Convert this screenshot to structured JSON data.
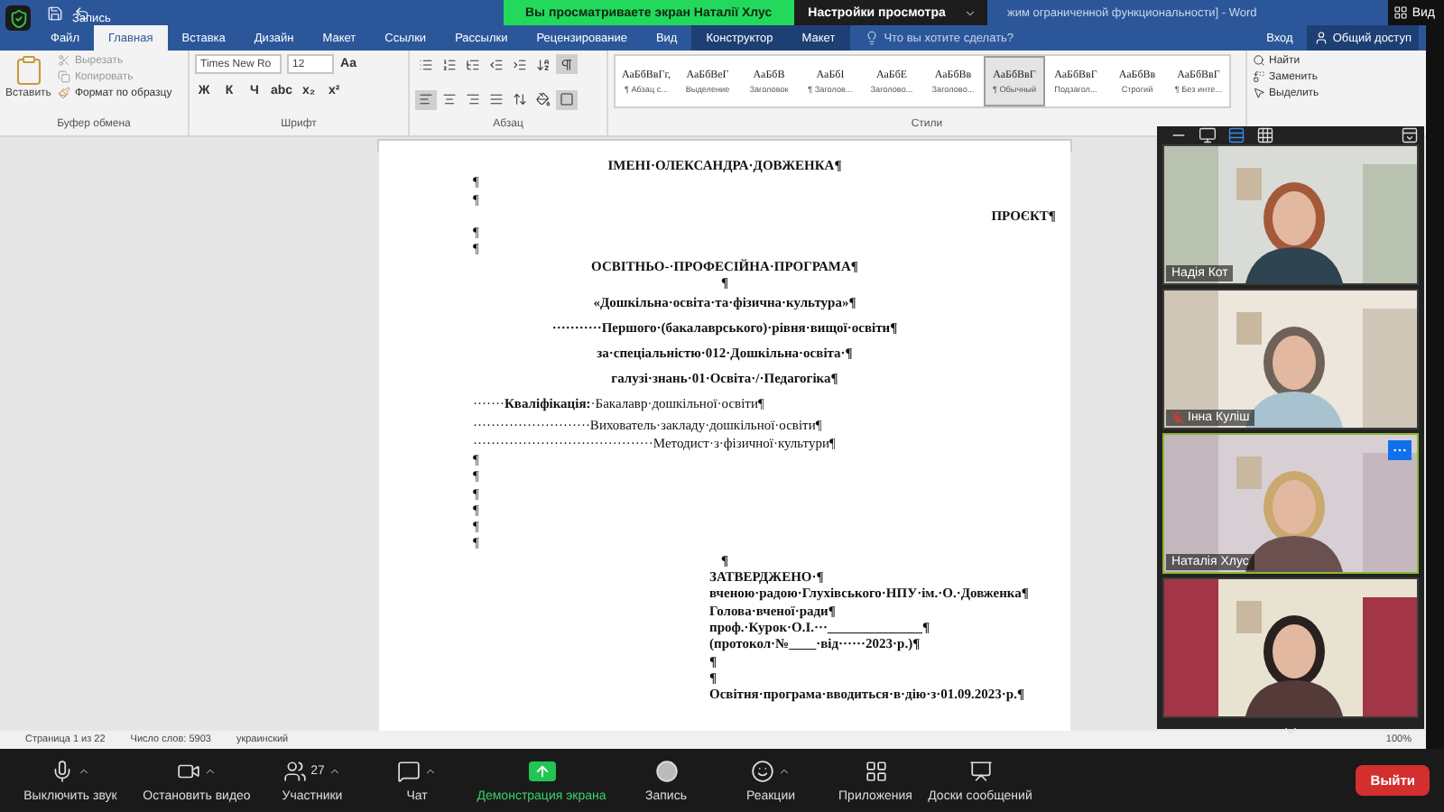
{
  "zoom_header": {
    "recording_label": "Запись",
    "view_button": "Вид"
  },
  "share_banner": {
    "text": "Вы просматриваете экран Наталії Хлус",
    "options_button": "Настройки просмотра"
  },
  "window": {
    "title": "жим ограниченной функциональности] - Word"
  },
  "ribbon_tabs": [
    {
      "label": "Файл",
      "selected": false,
      "contextual": false
    },
    {
      "label": "Главная",
      "selected": true,
      "contextual": false
    },
    {
      "label": "Вставка",
      "selected": false,
      "contextual": false
    },
    {
      "label": "Дизайн",
      "selected": false,
      "contextual": false
    },
    {
      "label": "Макет",
      "selected": false,
      "contextual": false
    },
    {
      "label": "Ссылки",
      "selected": false,
      "contextual": false
    },
    {
      "label": "Рассылки",
      "selected": false,
      "contextual": false
    },
    {
      "label": "Рецензирование",
      "selected": false,
      "contextual": false
    },
    {
      "label": "Вид",
      "selected": false,
      "contextual": false
    },
    {
      "label": "Конструктор",
      "selected": false,
      "contextual": true
    },
    {
      "label": "Макет",
      "selected": false,
      "contextual": true
    }
  ],
  "tell_me": {
    "placeholder": "Что вы хотите сделать?"
  },
  "account": {
    "sign_in": "Вход",
    "share": "Общий доступ"
  },
  "clipboard": {
    "paste": "Вставить",
    "cut": "Вырезать",
    "copy": "Копировать",
    "format_painter": "Формат по образцу",
    "group": "Буфер обмена"
  },
  "font": {
    "name": "Times New Ro",
    "size": "12",
    "change_case": "Aa",
    "buttons": [
      "Ж",
      "К",
      "Ч",
      "abc",
      "x₂",
      "x²"
    ],
    "group": "Шрифт"
  },
  "paragraph": {
    "group": "Абзац",
    "buttons": [
      {
        "kind": "bullets",
        "on": false
      },
      {
        "kind": "numbering",
        "on": false
      },
      {
        "kind": "multilevel",
        "on": false
      },
      {
        "kind": "outdent",
        "on": false
      },
      {
        "kind": "indent",
        "on": false
      },
      {
        "kind": "sort",
        "on": false
      },
      {
        "kind": "marks",
        "on": true
      },
      {
        "kind": "align-left",
        "on": true
      },
      {
        "kind": "align-center",
        "on": false
      },
      {
        "kind": "align-right",
        "on": false
      },
      {
        "kind": "justify",
        "on": false
      },
      {
        "kind": "spacing",
        "on": false
      },
      {
        "kind": "shading",
        "on": false
      },
      {
        "kind": "borders",
        "on": true
      }
    ]
  },
  "styles": {
    "group": "Стили",
    "items": [
      {
        "sample": "АаБбВвГг,",
        "label": "¶ Абзац с...",
        "selected": false
      },
      {
        "sample": "АаБбВеГ",
        "label": "Выделение",
        "selected": false
      },
      {
        "sample": "АаБбВ",
        "label": "Заголовок",
        "selected": false
      },
      {
        "sample": "АаБбІ",
        "label": "¶ Заголов...",
        "selected": false
      },
      {
        "sample": "АаБбЕ",
        "label": "Заголово...",
        "selected": false
      },
      {
        "sample": "АаБбВв",
        "label": "Заголово...",
        "selected": false
      },
      {
        "sample": "АаБбВвГ",
        "label": "¶ Обычный",
        "selected": true
      },
      {
        "sample": "АаБбВвГ",
        "label": "Подзагол...",
        "selected": false
      },
      {
        "sample": "АаБбВв",
        "label": "Строгий",
        "selected": false
      },
      {
        "sample": "АаБбВвГ",
        "label": "¶ Без инте...",
        "selected": false
      }
    ]
  },
  "editing": {
    "find": "Найти",
    "replace": "Заменить",
    "select": "Выделить"
  },
  "document": {
    "lines": [
      {
        "text": "ІМЕНІ·ОЛЕКСАНДРА·ДОВЖЕНКА¶",
        "kind": "center",
        "bold": true
      },
      {
        "text": "¶",
        "kind": "left",
        "bold": false
      },
      {
        "text": "¶",
        "kind": "left",
        "bold": false
      },
      {
        "text": "ПРОЄКТ¶",
        "kind": "right",
        "bold": true
      },
      {
        "text": "¶",
        "kind": "left",
        "bold": false
      },
      {
        "text": "¶",
        "kind": "left",
        "bold": false
      },
      {
        "text": "ОСВІТНЬО-·ПРОФЕСІЙНА·ПРОГРАМА¶",
        "kind": "center",
        "bold": true
      },
      {
        "text": "¶",
        "kind": "center",
        "bold": true
      },
      {
        "text": "«Дошкільна·освіта·та·фізична·культура»¶",
        "kind": "center",
        "bold": true,
        "spaced": true
      },
      {
        "text": "···········Першого·(бакалаврського)·рівня·вищої·освіти¶",
        "kind": "center",
        "bold": true,
        "spaced": true
      },
      {
        "text": "за·спеціальністю·012·Дошкільна·освіта·¶",
        "kind": "center",
        "bold": true,
        "spaced": true
      },
      {
        "text": "галузі·знань·01·Освіта·/·Педагогіка¶",
        "kind": "center",
        "bold": true,
        "spaced": true
      },
      {
        "text": "·······**Кваліфікація:**·Бакалавр·дошкільної·освіти¶",
        "kind": "left",
        "bold": false,
        "spaced": true
      },
      {
        "text": "··························Вихователь·закладу·дошкільної·освіти¶",
        "kind": "left",
        "bold": false,
        "spaced": false
      },
      {
        "text": "········································Методист·з·фізичної·культури¶",
        "kind": "left",
        "bold": false,
        "spaced": false
      },
      {
        "text": "¶",
        "kind": "left",
        "bold": false
      },
      {
        "text": "¶",
        "kind": "left",
        "bold": false
      },
      {
        "text": "¶",
        "kind": "left",
        "bold": false
      },
      {
        "text": "¶",
        "kind": "left",
        "bold": false
      },
      {
        "text": "¶",
        "kind": "left",
        "bold": false
      },
      {
        "text": "¶",
        "kind": "left",
        "bold": false
      },
      {
        "text": "¶",
        "kind": "center",
        "bold": true
      },
      {
        "text": "ЗАТВЕРДЖЕНО·¶",
        "kind": "approval",
        "bold": true
      },
      {
        "text": "вченою·радою·Глухівського·НПУ·ім.·О.·Довженка¶",
        "kind": "approval",
        "bold": true
      },
      {
        "text": "Голова·вченої·ради¶",
        "kind": "approval",
        "bold": true
      },
      {
        "text": "проф.·Курок·О.І.···______________¶",
        "kind": "approval",
        "bold": true
      },
      {
        "text": "(протокол·№____·від······2023·р.)¶",
        "kind": "approval",
        "bold": true
      },
      {
        "text": "¶",
        "kind": "approval",
        "bold": true
      },
      {
        "text": "¶",
        "kind": "approval",
        "bold": true
      },
      {
        "text": "Освітня·програма·вводиться·в·дію·з·01.09.2023·р.¶",
        "kind": "approval",
        "bold": true
      }
    ]
  },
  "status_bar": {
    "page": "Страница 1 из 22",
    "words": "Число слов: 5903",
    "language": "украинский",
    "zoom": "100%"
  },
  "gallery": {
    "participants": [
      {
        "name": "Надія Кот",
        "muted": false,
        "speaking": false
      },
      {
        "name": "Інна Куліш",
        "muted": true,
        "speaking": false
      },
      {
        "name": "Наталія Хлус",
        "muted": false,
        "speaking": true
      },
      {
        "speaking": false
      }
    ]
  },
  "toolbar": {
    "items": [
      {
        "kind": "mic",
        "label": "Выключить звук",
        "caret": true
      },
      {
        "kind": "video",
        "label": "Остановить видео",
        "caret": true
      },
      {
        "kind": "participants",
        "label": "Участники",
        "count": "27",
        "caret": true
      },
      {
        "kind": "chat",
        "label": "Чат",
        "caret": true
      },
      {
        "kind": "share",
        "label": "Демонстрация экрана",
        "caret": false
      },
      {
        "kind": "record",
        "label": "Запись",
        "caret": false
      },
      {
        "kind": "reactions",
        "label": "Реакции",
        "caret": true
      },
      {
        "kind": "apps",
        "label": "Приложения",
        "caret": false
      },
      {
        "kind": "whiteboard",
        "label": "Доски сообщений",
        "caret": false
      }
    ],
    "leave": "Выйти"
  }
}
